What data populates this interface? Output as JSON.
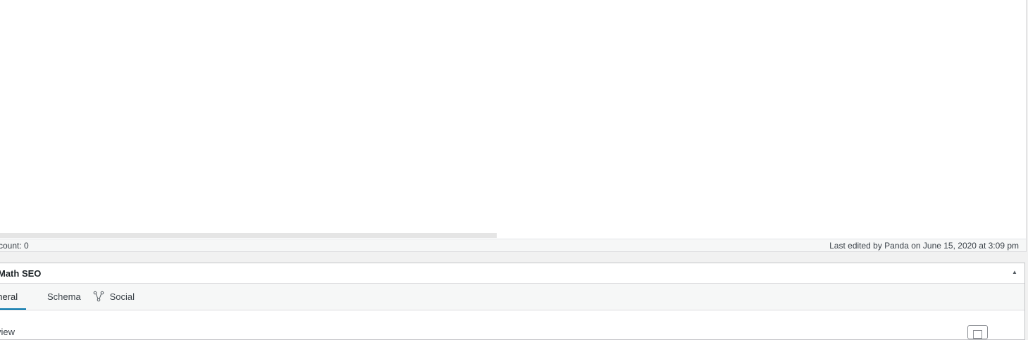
{
  "editor": {
    "word_count": "count: 0",
    "last_edited": "Last edited by Panda on June 15, 2020 at 3:09 pm"
  },
  "seo_box": {
    "title": "Math SEO",
    "toggle_icon": "triangle-up-icon",
    "tabs": [
      {
        "label": "eneral",
        "active": true
      },
      {
        "label": "Schema",
        "active": false
      },
      {
        "label": "Social",
        "active": false,
        "icon": "share-nodes-icon"
      }
    ],
    "preview_label": "view"
  },
  "colors": {
    "accent": "#0073aa",
    "background": "#f1f1f1",
    "panel": "#ffffff"
  }
}
